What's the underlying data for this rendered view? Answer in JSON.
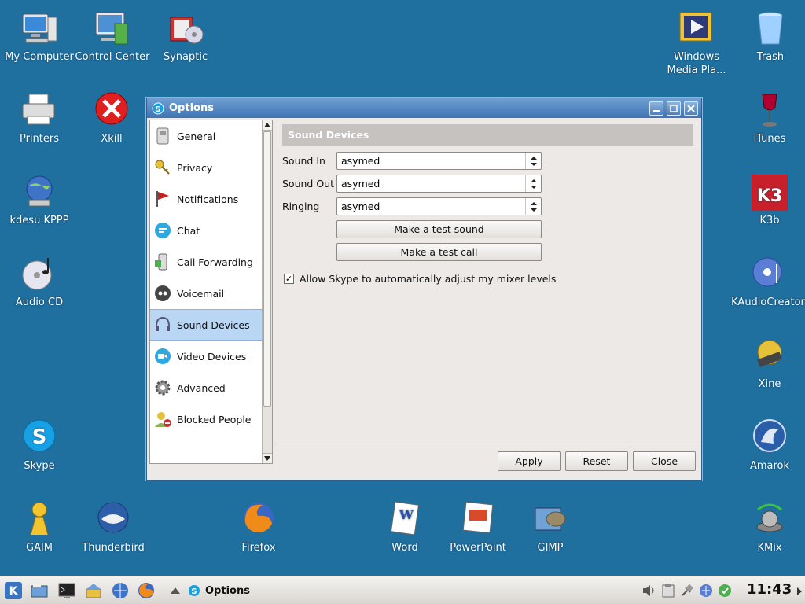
{
  "desktop": {
    "icons": {
      "my_computer": "My Computer",
      "control_center": "Control Center",
      "synaptic": "Synaptic",
      "windows_media": "Windows Media Pla...",
      "trash": "Trash",
      "printers": "Printers",
      "xkill": "Xkill",
      "itunes": "iTunes",
      "kdesu_kppp": "kdesu KPPP",
      "k3b": "K3b",
      "audio_cd": "Audio CD",
      "kaudiocreator": "KAudioCreator",
      "xine": "Xine",
      "skype": "Skype",
      "amarok": "Amarok",
      "gaim": "GAIM",
      "thunderbird": "Thunderbird",
      "firefox": "Firefox",
      "word": "Word",
      "powerpoint": "PowerPoint",
      "gimp": "GIMP",
      "kmix": "KMix"
    }
  },
  "window": {
    "title": "Options",
    "sidebar": {
      "items": [
        {
          "label": "General"
        },
        {
          "label": "Privacy"
        },
        {
          "label": "Notifications"
        },
        {
          "label": "Chat"
        },
        {
          "label": "Call Forwarding"
        },
        {
          "label": "Voicemail"
        },
        {
          "label": "Sound Devices"
        },
        {
          "label": "Video Devices"
        },
        {
          "label": "Advanced"
        },
        {
          "label": "Blocked People"
        }
      ],
      "selected": "Sound Devices"
    },
    "panel": {
      "header": "Sound Devices",
      "sound_in_label": "Sound In",
      "sound_in_value": "asymed",
      "sound_out_label": "Sound Out",
      "sound_out_value": "asymed",
      "ringing_label": "Ringing",
      "ringing_value": "asymed",
      "test_sound_button": "Make a test sound",
      "test_call_button": "Make a test call",
      "auto_adjust_label": "Allow Skype to automatically adjust my mixer levels",
      "auto_adjust_checked": true
    },
    "footer": {
      "apply": "Apply",
      "reset": "Reset",
      "close": "Close"
    }
  },
  "taskbar": {
    "task_label": "Options",
    "clock": "11:43"
  },
  "colors": {
    "desktop_bg": "#1f6f9f",
    "titlebar": "#3f74b3",
    "selection": "#b9d6f5"
  }
}
